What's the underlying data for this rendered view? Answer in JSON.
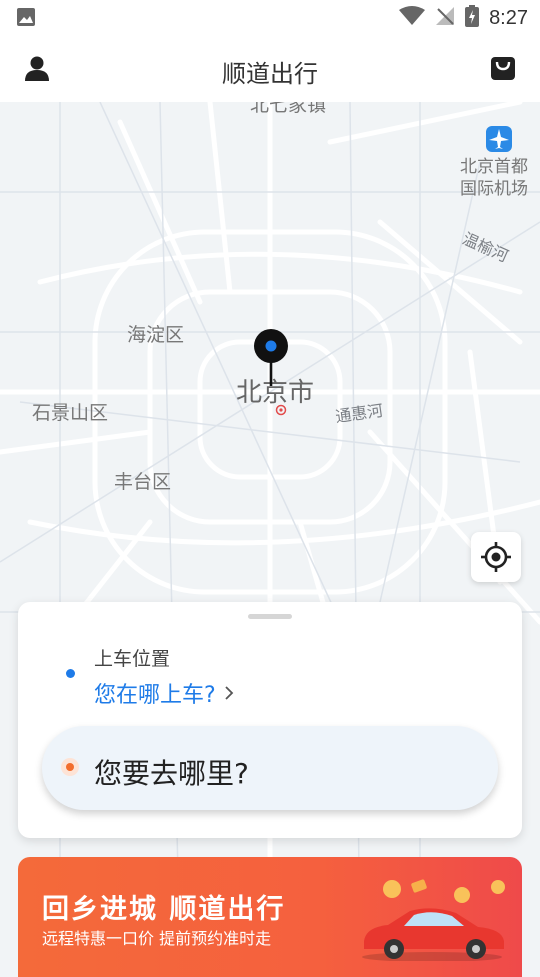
{
  "status": {
    "time": "8:27"
  },
  "header": {
    "title": "顺道出行"
  },
  "map": {
    "labels": {
      "beiqijia": "北七家镇",
      "airport_line1": "北京首都",
      "airport_line2": "国际机场",
      "wenyu": "温榆河",
      "haidian": "海淀区",
      "beijing": "北京市",
      "tonghui": "通惠河",
      "shijingshan": "石景山区",
      "fengtai": "丰台区"
    }
  },
  "card": {
    "pickup_label": "上车位置",
    "pickup_value": "您在哪上车?",
    "destination_placeholder": "您要去哪里?"
  },
  "banner": {
    "headline": "回乡进城 顺道出行",
    "subline": "远程特惠一口价 提前预约准时走"
  },
  "colors": {
    "accent_blue": "#1e7be8",
    "accent_orange": "#f26d2d",
    "banner": "#f46a3a"
  }
}
